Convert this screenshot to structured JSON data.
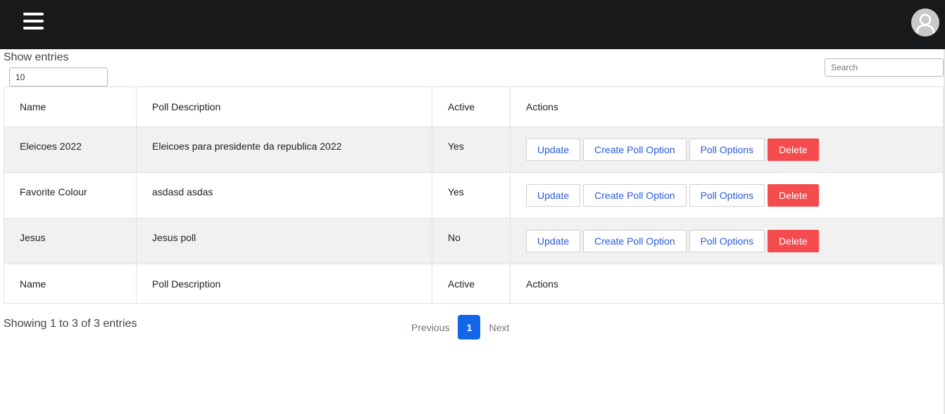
{
  "header": {
    "menu_icon": "hamburger-menu-icon",
    "avatar_icon": "user-avatar-icon"
  },
  "controls": {
    "show_entries_label": "Show entries",
    "entries_value": "10",
    "search_placeholder": "Search"
  },
  "table": {
    "columns": [
      "Name",
      "Poll Description",
      "Active",
      "Actions"
    ],
    "rows": [
      {
        "name": "Eleicoes 2022",
        "description": "Eleicoes para presidente da republica 2022",
        "active": "Yes"
      },
      {
        "name": "Favorite Colour",
        "description": "asdasd asdas",
        "active": "Yes"
      },
      {
        "name": "Jesus",
        "description": "Jesus poll",
        "active": "No"
      }
    ],
    "actions": {
      "update": "Update",
      "create_option": "Create Poll Option",
      "options": "Poll Options",
      "delete": "Delete"
    }
  },
  "footer": {
    "info": "Showing 1 to 3 of 3 entries",
    "previous": "Previous",
    "current_page": "1",
    "next": "Next"
  },
  "colors": {
    "topbar": "#18191b",
    "link_blue": "#2a5bd7",
    "danger": "#f44b4e",
    "page_active": "#1466e8",
    "stripe": "#f1f1f1"
  }
}
